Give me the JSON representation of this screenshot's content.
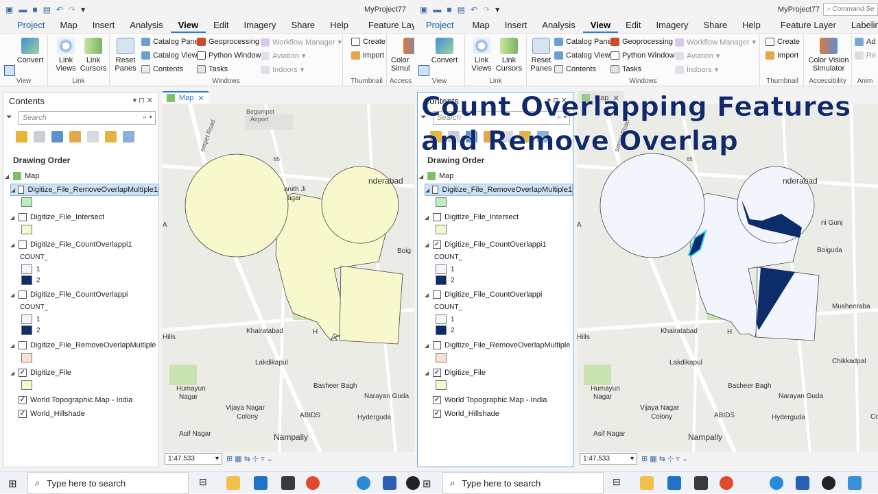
{
  "project_name": "MyProject77",
  "command_search_placeholder": "Command Se",
  "ribbon_tabs_left": [
    "Project",
    "Map",
    "Insert",
    "Analysis",
    "View",
    "Edit",
    "Imagery",
    "Share",
    "Help",
    "Feature Layer"
  ],
  "ribbon_tabs_right": [
    "Project",
    "Map",
    "Insert",
    "Analysis",
    "View",
    "Edit",
    "Imagery",
    "Share",
    "Help",
    "Feature Layer",
    "Labeling"
  ],
  "active_tab": "View",
  "ribbon": {
    "convert": "Convert",
    "link_views": "Link Views",
    "link_cursors": "Link Cursors",
    "reset_panes": "Reset Panes",
    "catalog_pane": "Catalog Pane",
    "catalog_view": "Catalog View",
    "contents": "Contents",
    "geoprocessing": "Geoprocessing",
    "python_window": "Python Window",
    "tasks": "Tasks",
    "workflow_manager": "Workflow Manager",
    "aviation": "Aviation",
    "indoors": "Indoors",
    "create": "Create",
    "import": "Import",
    "color_vision_left": "Color Simul",
    "color_vision_right": "Color Vision Simulator",
    "ad": "Ad",
    "re": "Re",
    "groups": {
      "view": "View",
      "link": "Link",
      "windows": "Windows",
      "thumbnail": "Thumbnail",
      "access": "Access",
      "accessibility": "Accessibility",
      "anim": "Anim"
    }
  },
  "contents": {
    "title": "Contents",
    "search_placeholder": "Search",
    "drawing_order": "Drawing Order",
    "map": "Map",
    "layers": [
      {
        "name": "Digitize_File_RemoveOverlapMultiple1",
        "checked_left": false,
        "checked_right": false
      },
      {
        "name": "Digitize_File_Intersect",
        "checked_left": false,
        "checked_right": false
      },
      {
        "name": "Digitize_File_CountOverlappi1",
        "checked_left": false,
        "checked_right": true
      },
      {
        "name": "Digitize_File_CountOverlappi",
        "checked_left": false,
        "checked_right": false
      },
      {
        "name": "Digitize_File_RemoveOverlapMultiple",
        "checked_left": false,
        "checked_right": false
      },
      {
        "name": "Digitize_File",
        "checked_left": true,
        "checked_right": true
      },
      {
        "name": "World Topographic Map - India",
        "checked_left": true,
        "checked_right": true
      },
      {
        "name": "World_Hillshade",
        "checked_left": true,
        "checked_right": true
      }
    ],
    "count_label": "COUNT_",
    "count_values": [
      "1",
      "2"
    ]
  },
  "map_tab": "Map",
  "map_labels": {
    "begumpet": "Begumpet",
    "airport": "Airport",
    "panchir_road": "ampet Road",
    "road65": "65",
    "nanith": "anith Ji",
    "nagar": "agar",
    "nderabad": "nderabad",
    "boigu": "Boig",
    "boiguda": "Boiguda",
    "ni_gunj": "ni Gunj",
    "hills": "Hills",
    "khairatabad": "Khairatabad",
    "lakdikapul": "Lakdikapul",
    "basheer_bagh": "Basheer Bagh",
    "humayun": "Humayun",
    "nagar2": "Nagar",
    "vijaya": "Vijaya Nagar",
    "colony": "Colony",
    "abids": "ABIDS",
    "narayan": "Narayan Guda",
    "hyderguda": "Hyderguda",
    "asif": "Asif Nagar",
    "nampally": "Nampally",
    "musheerabad": "Musheeraba",
    "chikkadpalli": "Chikkadpal",
    "co": "Co",
    "h": "H",
    "a": "A"
  },
  "scale": "1:47,533",
  "overlay_title_line1": "Count Overlapping Features",
  "overlay_title_line2": "and Remove Overlap",
  "taskbar_search": "Type here to search",
  "colors": {
    "polygon_fill": "#f7f8cc",
    "count1": "#f2f6fc",
    "count2": "#0c2d69",
    "accent": "#2f7bd1",
    "remove_overlap_swatch": "#b9f0bd",
    "remove_overlap_multiple_swatch": "#fde0d4"
  }
}
